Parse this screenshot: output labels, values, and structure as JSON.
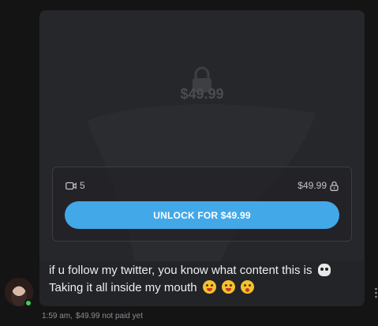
{
  "locked_post": {
    "preview_price": "$49.99",
    "media_count": "5",
    "price": "$49.99",
    "unlock_button_label": "UNLOCK FOR $49.99"
  },
  "message": {
    "line1": "if u follow my twitter, you know what content this is",
    "line2": "Taking it all inside my mouth"
  },
  "meta": {
    "time": "1:59 am,",
    "status": "$49.99 not paid yet"
  },
  "colors": {
    "accent": "#43a8e8",
    "online": "#3ccf5a"
  }
}
